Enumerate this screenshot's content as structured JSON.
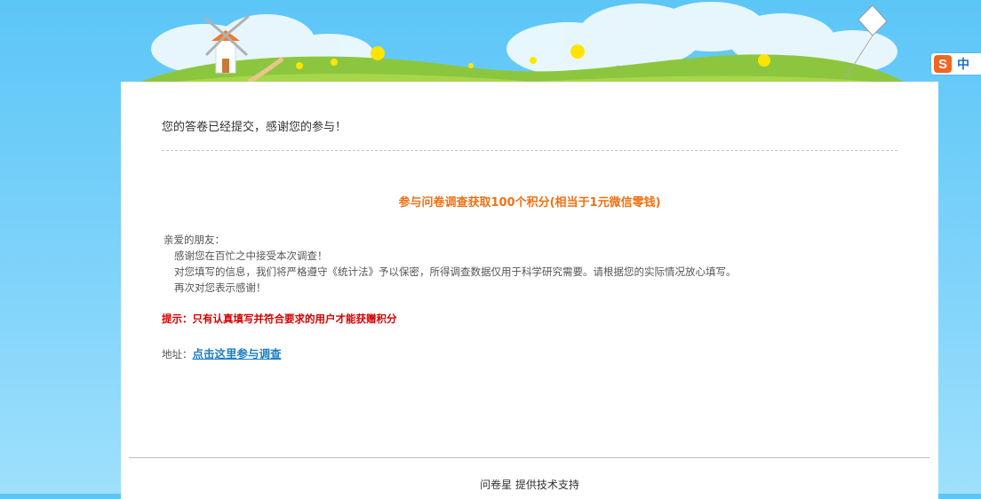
{
  "survey": {
    "submitted_message": "您的答卷已经提交，感谢您的参与！",
    "reward_text": "参与问卷调查获取100个积分(相当于1元微信零钱)",
    "letter": {
      "greeting": "亲爱的朋友：",
      "line1": "感谢您在百忙之中接受本次调查！",
      "line2": "对您填写的信息，我们将严格遵守《统计法》予以保密，所得调查数据仅用于科学研究需要。请根据您的实际情况放心填写。",
      "line3": "再次对您表示感谢！"
    },
    "tip": "提示：只有认真填写并符合要求的用户才能获赠积分",
    "address_label": "地址：",
    "address_link": "点击这里参与调查"
  },
  "footer": {
    "text": "问卷星 提供技术支持"
  },
  "ime": {
    "logo": "S",
    "mode": "中"
  },
  "colors": {
    "accent_orange": "#f07012",
    "tip_red": "#d40000",
    "link_blue": "#1e7fc2",
    "sky": "#5cc6f7"
  }
}
